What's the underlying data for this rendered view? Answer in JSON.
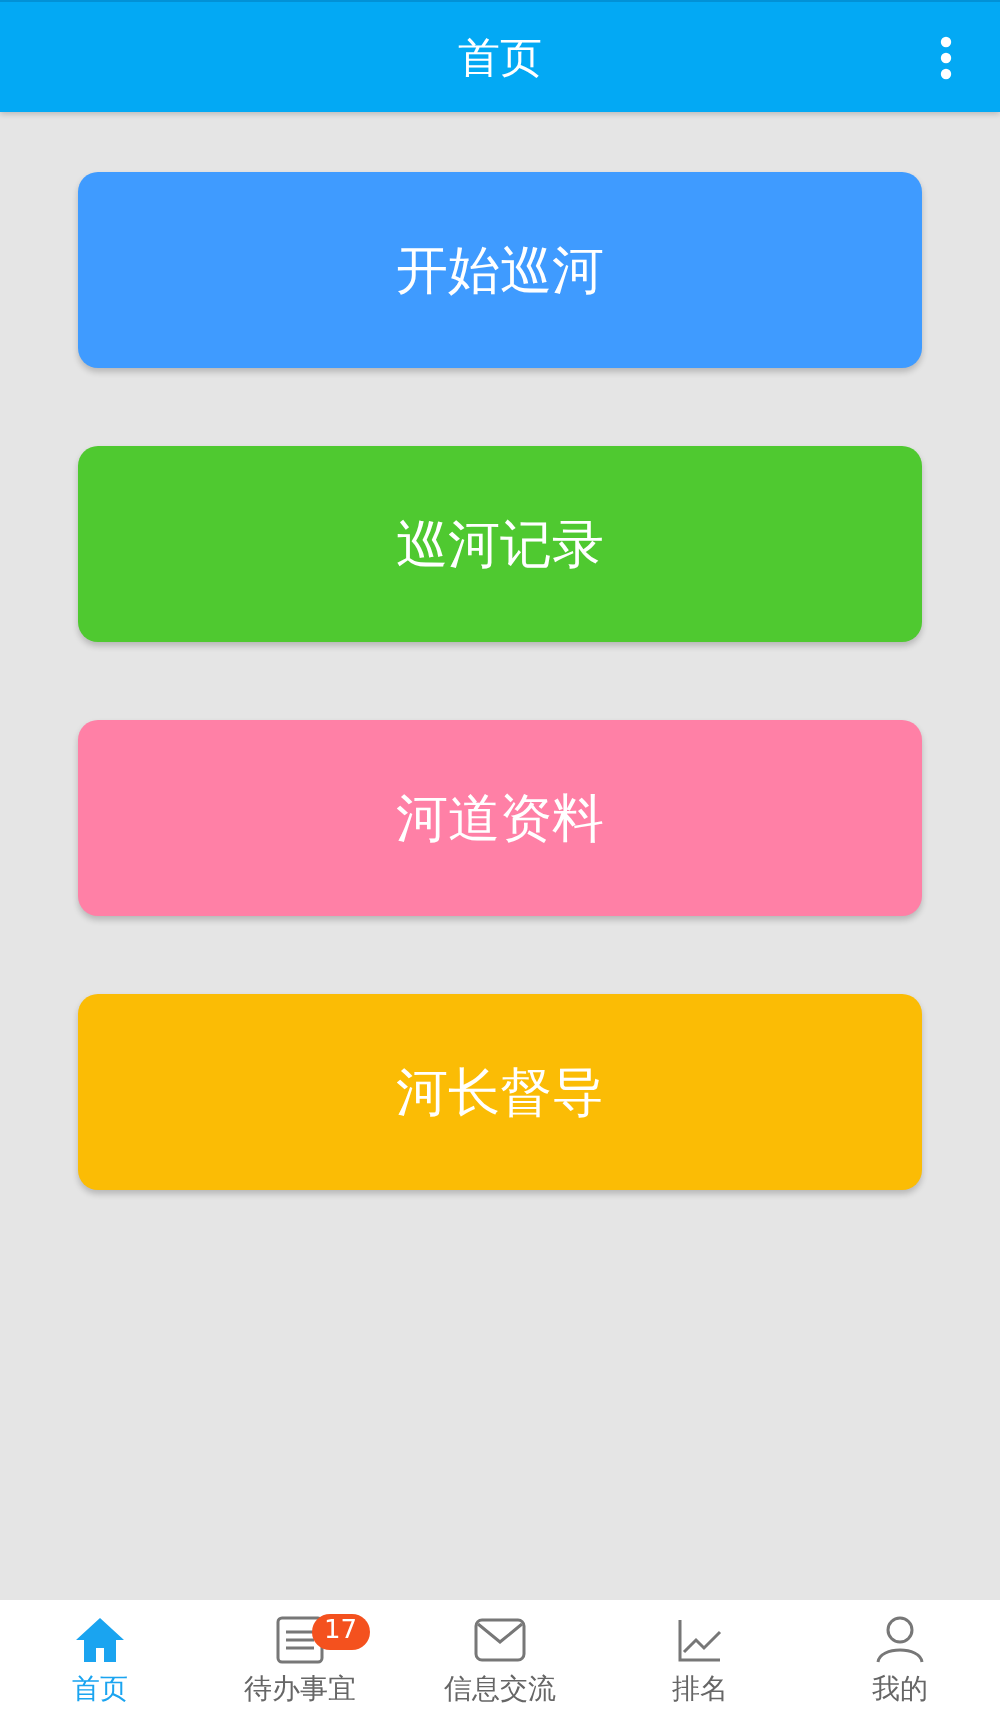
{
  "header": {
    "title": "首页"
  },
  "actions": [
    {
      "label": "开始巡河",
      "color": "#3f9bff"
    },
    {
      "label": "巡河记录",
      "color": "#4fc930"
    },
    {
      "label": "河道资料",
      "color": "#ff80a6"
    },
    {
      "label": "河长督导",
      "color": "#fbbc05"
    }
  ],
  "tab_bar": [
    {
      "kind": "home",
      "label": "首页",
      "selected": true
    },
    {
      "kind": "list",
      "label": "待办事宜",
      "selected": false,
      "badge": "17"
    },
    {
      "kind": "mail",
      "label": "信息交流",
      "selected": false
    },
    {
      "kind": "chart",
      "label": "排名",
      "selected": false
    },
    {
      "kind": "person",
      "label": "我的",
      "selected": false
    }
  ]
}
